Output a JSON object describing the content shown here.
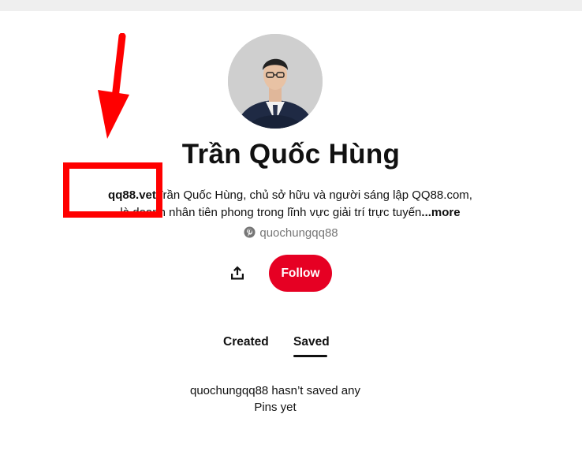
{
  "profile": {
    "name": "Trần Quốc Hùng",
    "bio_lead": "qq88.vet",
    "bio_line1": "Trần Quốc Hùng, chủ sở hữu và người sáng lập QQ88.com,",
    "bio_line2": "là doanh nhân tiên phong trong lĩnh vực giải trí trực tuyến",
    "bio_more": "...more",
    "username": "quochungqq88"
  },
  "actions": {
    "follow_label": "Follow"
  },
  "tabs": [
    {
      "label": "Created",
      "active": false
    },
    {
      "label": "Saved",
      "active": true
    }
  ],
  "empty_state": {
    "message_line1": "quochungqq88 hasn’t saved any",
    "message_line2": "Pins yet"
  },
  "icons": {
    "share": "share-icon",
    "pinterest": "pinterest-icon"
  },
  "colors": {
    "accent": "#e60023",
    "muted_text": "#767676",
    "annotation": "#ff0000"
  }
}
